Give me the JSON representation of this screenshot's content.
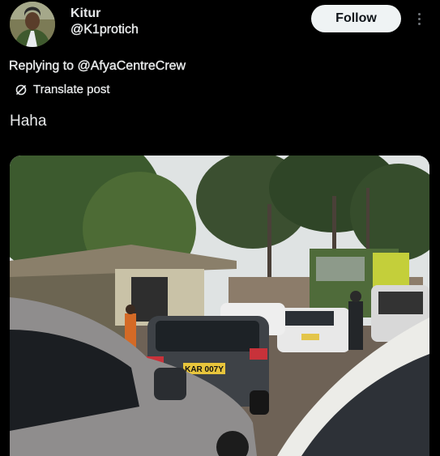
{
  "post": {
    "author": {
      "name": "Kitur",
      "handle": "@K1protich",
      "avatar_icon": "profile-photo"
    },
    "follow_label": "Follow",
    "more_icon": "three-dots-vertical-icon",
    "replying_to": "Replying to @AfyaCentreCrew",
    "translate_label": "Translate post",
    "translate_icon": "translate-globe-icon",
    "text": "Haha",
    "media": {
      "plate_text": "KAR 007Y"
    }
  },
  "colors": {
    "background": "#000000",
    "text": "#e7e9ea",
    "muted": "#71767b",
    "follow_bg": "#eff3f4",
    "follow_text": "#0f1419"
  }
}
